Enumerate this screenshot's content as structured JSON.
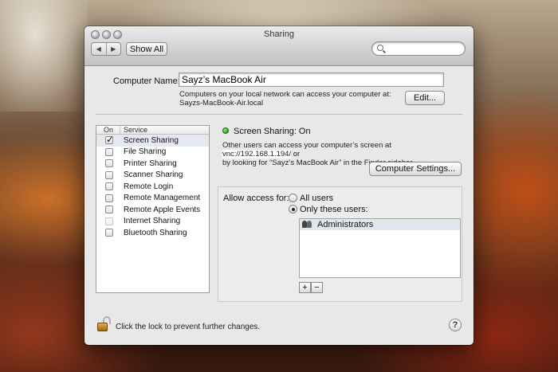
{
  "window": {
    "title": "Sharing"
  },
  "toolbar": {
    "back_icon": "◀",
    "forward_icon": "▶",
    "show_all_label": "Show All",
    "search_placeholder": ""
  },
  "computer_name": {
    "label": "Computer Name:",
    "value": "Sayz’s MacBook Air",
    "note_line1": "Computers on your local network can access your computer at:",
    "note_line2": "Sayzs-MacBook-Air.local",
    "edit_label": "Edit..."
  },
  "services": {
    "header_on": "On",
    "header_service": "Service",
    "items": [
      {
        "label": "Screen Sharing",
        "checked": true,
        "selected": true
      },
      {
        "label": "File Sharing",
        "checked": false
      },
      {
        "label": "Printer Sharing",
        "checked": false
      },
      {
        "label": "Scanner Sharing",
        "checked": false
      },
      {
        "label": "Remote Login",
        "checked": false
      },
      {
        "label": "Remote Management",
        "checked": false
      },
      {
        "label": "Remote Apple Events",
        "checked": false
      },
      {
        "label": "Internet Sharing",
        "checked": false
      },
      {
        "label": "Bluetooth Sharing",
        "checked": false
      }
    ]
  },
  "status": {
    "title": "Screen Sharing: On",
    "desc_prefix": "Other users can access your computer’s screen at ",
    "vnc_url": "vnc://192.168.1.194/",
    "desc_suffix": " or",
    "desc_line2": "by looking for “Sayz’s MacBook Air” in the Finder sidebar.",
    "computer_settings_label": "Computer Settings..."
  },
  "access": {
    "label": "Allow access for:",
    "option_all": "All users",
    "option_only": "Only these users:",
    "selected_option": "only",
    "users": [
      "Administrators"
    ],
    "add_label": "+",
    "remove_label": "−"
  },
  "footer": {
    "lock_text": "Click the lock to prevent further changes.",
    "help_label": "?"
  }
}
